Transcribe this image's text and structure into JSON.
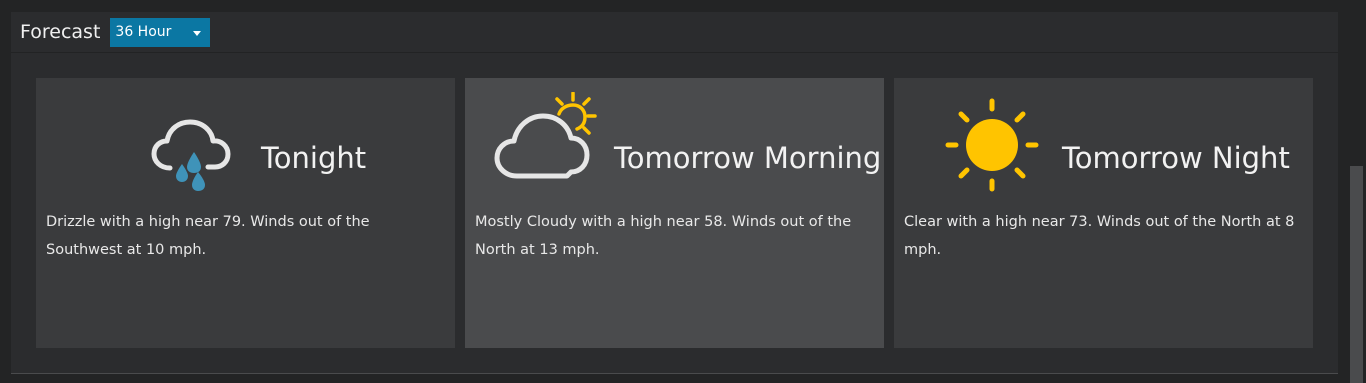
{
  "header": {
    "title": "Forecast",
    "range_select": {
      "value": "36 Hour"
    }
  },
  "cards": [
    {
      "title": "Tonight",
      "description": "Drizzle with a high near 79. Winds out of the Southwest at 10 mph.",
      "icon": "drizzle-icon"
    },
    {
      "title": "Tomorrow Morning",
      "description": "Mostly Cloudy with a high near 58. Winds out of the North at 13 mph.",
      "icon": "mostly-cloudy-icon"
    },
    {
      "title": "Tomorrow Night",
      "description": "Clear with a high near 73. Winds out of the North at 8 mph.",
      "icon": "clear-sun-icon"
    }
  ],
  "colors": {
    "accent": "#0b77a3",
    "sun": "#ffc400",
    "rain": "#3f93b9",
    "cloud_outline": "#e6e6e6"
  }
}
